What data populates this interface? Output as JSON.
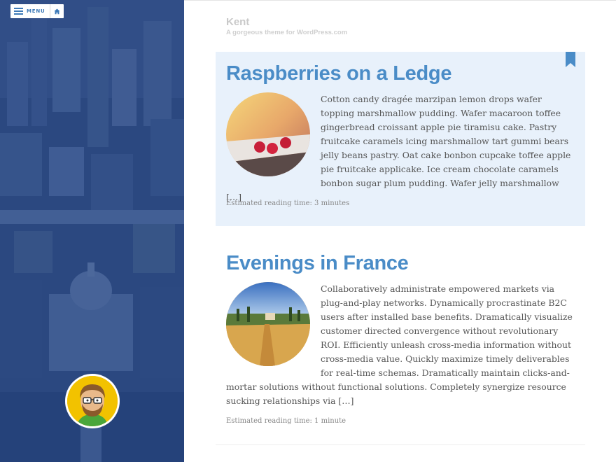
{
  "nav": {
    "menu_label": "MENU",
    "menu_icon": "hamburger-icon",
    "home_icon": "home-icon"
  },
  "site": {
    "title": "Kent",
    "description": "A gorgeous theme for WordPress.com"
  },
  "colors": {
    "accent": "#4a8cc7",
    "sidebar": "#1f3a72",
    "sticky_bg": "#e8f1fb"
  },
  "posts": [
    {
      "title": "Raspberries on a Ledge",
      "excerpt": "Cotton candy dragée marzipan lemon drops wafer topping marshmallow pudding. Wafer macaroon toffee gingerbread croissant apple pie tiramisu cake. Pastry fruitcake caramels icing marshmallow tart gummi bears jelly beans pastry. Oat cake bonbon cupcake toffee apple pie fruitcake applicake. Ice cream chocolate caramels bonbon sugar plum pudding. Wafer jelly marshmallow […]",
      "reading_time": "Estimated reading time: 3 minutes",
      "sticky_icon": "bookmark-icon"
    },
    {
      "title": "Evenings in France",
      "excerpt": "Collaboratively administrate empowered markets via plug-and-play networks. Dynamically procrastinate B2C users after installed base benefits. Dramatically visualize customer directed convergence without revolutionary ROI. Efficiently unleash cross-media information without cross-media value. Quickly maximize timely deliverables for real-time schemas. Dramatically maintain clicks-and-mortar solutions without functional solutions. Completely synergize resource sucking relationships via […]",
      "reading_time": "Estimated reading time: 1 minute"
    }
  ]
}
